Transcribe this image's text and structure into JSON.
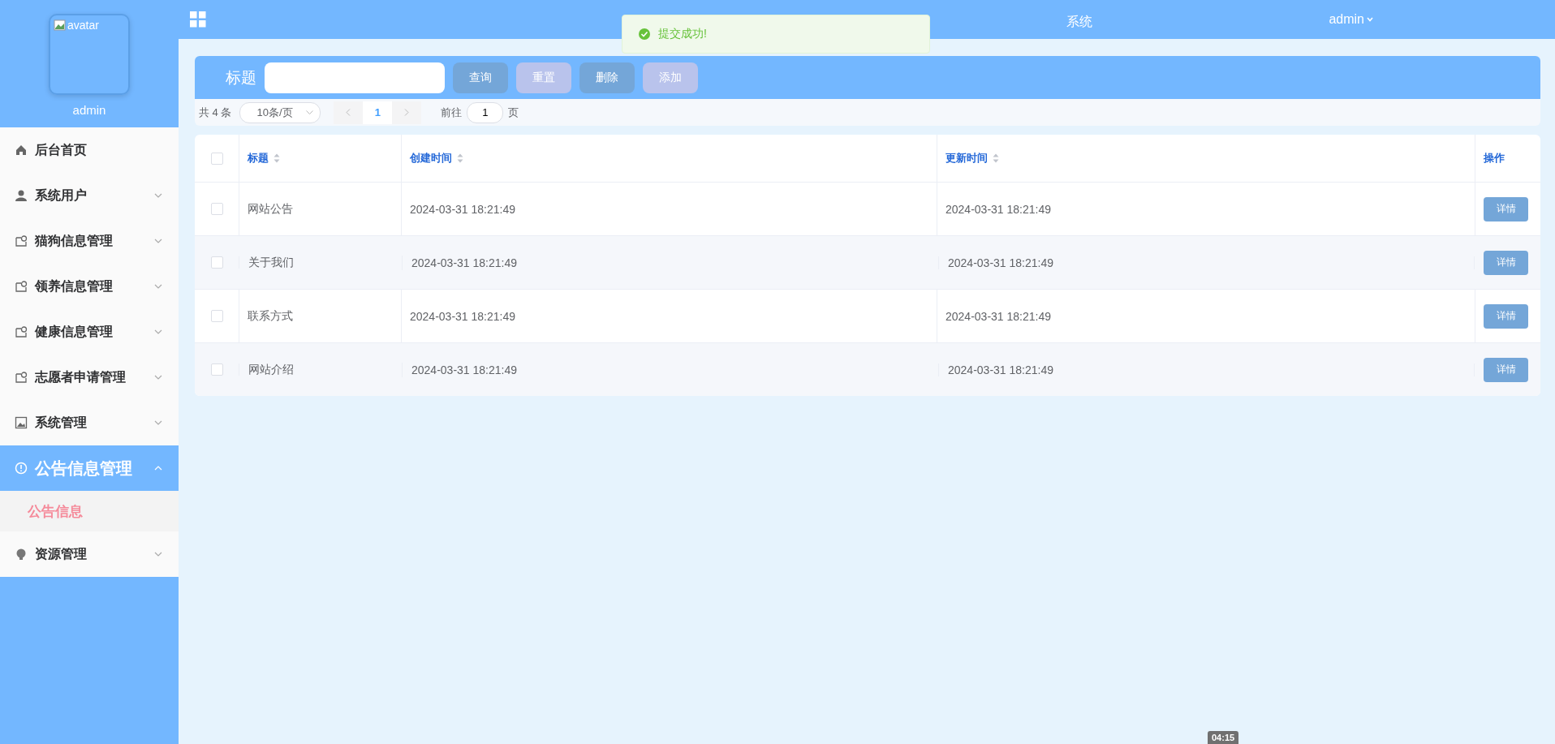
{
  "header": {
    "title_visible": "系统",
    "user": "admin"
  },
  "profile": {
    "avatar_alt": "avatar",
    "name": "admin"
  },
  "menu": [
    {
      "label": "后台首页",
      "kind": "home",
      "has_children": false,
      "expanded": false
    },
    {
      "label": "系统用户",
      "kind": "user",
      "has_children": true,
      "expanded": false
    },
    {
      "label": "猫狗信息管理",
      "kind": "tag",
      "has_children": true,
      "expanded": false
    },
    {
      "label": "领养信息管理",
      "kind": "tag",
      "has_children": true,
      "expanded": false
    },
    {
      "label": "健康信息管理",
      "kind": "tag",
      "has_children": true,
      "expanded": false
    },
    {
      "label": "志愿者申请管理",
      "kind": "tag",
      "has_children": true,
      "expanded": false
    },
    {
      "label": "系统管理",
      "kind": "image",
      "has_children": true,
      "expanded": false
    },
    {
      "label": "公告信息管理",
      "kind": "info",
      "has_children": true,
      "expanded": true,
      "children": [
        {
          "label": "公告信息",
          "selected": true
        }
      ]
    },
    {
      "label": "资源管理",
      "kind": "bulb",
      "has_children": true,
      "expanded": false
    }
  ],
  "toast": {
    "message": "提交成功!"
  },
  "search": {
    "label": "标题"
  },
  "buttons": [
    {
      "label": "查询",
      "kind": "primary"
    },
    {
      "label": "重置",
      "kind": "soft"
    },
    {
      "label": "删除",
      "kind": "primary"
    },
    {
      "label": "添加",
      "kind": "soft"
    }
  ],
  "pagination": {
    "total": "共 4 条",
    "page_size": "10条/页",
    "current": "1",
    "goto_label": "前往",
    "goto_value": "1",
    "page_unit": "页"
  },
  "table": {
    "all_checked": false,
    "columns": [
      {
        "label": "标题",
        "sortable": true
      },
      {
        "label": "创建时间",
        "sortable": true
      },
      {
        "label": "更新时间",
        "sortable": true
      },
      {
        "label": "操作",
        "sortable": false
      }
    ],
    "rows": [
      {
        "checked": false,
        "title": "网站公告",
        "created": "2024-03-31 18:21:49",
        "updated": "2024-03-31 18:21:49",
        "action": "详情"
      },
      {
        "checked": false,
        "title": "关于我们",
        "created": "2024-03-31 18:21:49",
        "updated": "2024-03-31 18:21:49",
        "action": "详情"
      },
      {
        "checked": false,
        "title": "联系方式",
        "created": "2024-03-31 18:21:49",
        "updated": "2024-03-31 18:21:49",
        "action": "详情"
      },
      {
        "checked": false,
        "title": "网站介绍",
        "created": "2024-03-31 18:21:49",
        "updated": "2024-03-31 18:21:49",
        "action": "详情"
      }
    ]
  },
  "video_time": "04:15"
}
